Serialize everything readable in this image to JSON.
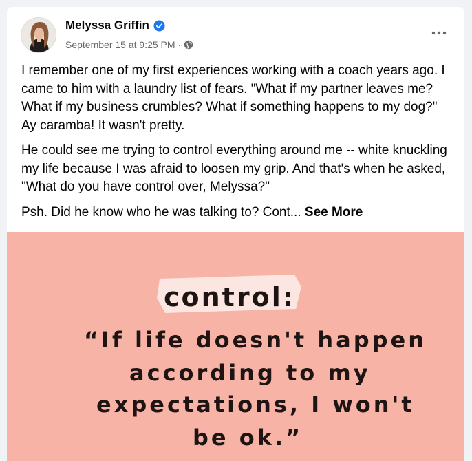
{
  "post": {
    "author_name": "Melyssa Griffin",
    "timestamp": "September 15 at 9:25 PM",
    "separator": "·",
    "audience_icon": "globe-icon",
    "verified_icon": "verified-badge-icon",
    "more_icon": "more-options-icon",
    "paragraphs": [
      "I remember one of my first experiences working with a coach years ago. I came to him with a laundry list of fears. \"What if my partner leaves me? What if my business crumbles? What if something happens to my dog?\" Ay caramba! It wasn't pretty.",
      "He could see me trying to control everything around me -- white knuckling my life because I was afraid to loosen my grip. And that's when he asked, \"What do you have control over, Melyssa?\""
    ],
    "truncated_paragraph": "Psh. Did he know who he was talking to? Cont...",
    "see_more_label": "See More"
  },
  "image": {
    "title": "control:",
    "quote_lines": [
      "“If life doesn't happen",
      "according to my",
      "expectations, I won't",
      "be ok.”"
    ],
    "background_color": "#f7b3a6"
  },
  "colors": {
    "page_background": "#f0f2f5",
    "verified_blue": "#1877f2",
    "secondary_text": "#65676b"
  }
}
